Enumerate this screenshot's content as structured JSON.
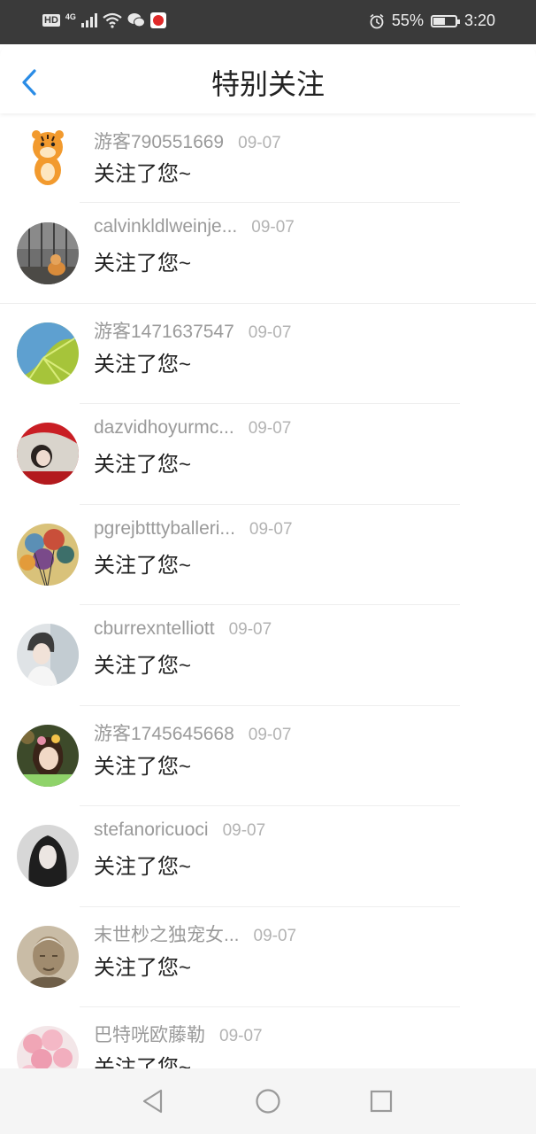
{
  "status_bar": {
    "hd": "HD",
    "network": "4G",
    "battery_percent": "55%",
    "time": "3:20",
    "battery_level": 0.55,
    "icons": [
      "hd-icon",
      "signal-icon",
      "wifi-icon",
      "wechat-icon",
      "app-icon",
      "alarm-icon",
      "battery-icon"
    ]
  },
  "header": {
    "title": "特别关注",
    "back_icon": "chevron-left-icon",
    "accent": "#2a8ce6"
  },
  "items": [
    {
      "username": "游客790551669",
      "date": "09-07",
      "message": "关注了您~",
      "avatar": "tiger-avatar"
    },
    {
      "username": "calvinkldlweinje...",
      "date": "09-07",
      "message": "关注了您~",
      "avatar": "cat-avatar"
    },
    {
      "username": "游客1471637547",
      "date": "09-07",
      "message": "关注了您~",
      "avatar": "leaf-avatar"
    },
    {
      "username": "dazvidhoyurmc...",
      "date": "09-07",
      "message": "关注了您~",
      "avatar": "girl-red-avatar"
    },
    {
      "username": "pgrejbtttyballeri...",
      "date": "09-07",
      "message": "关注了您~",
      "avatar": "balloons-avatar"
    },
    {
      "username": "cburrexntelliott",
      "date": "09-07",
      "message": "关注了您~",
      "avatar": "boy-avatar"
    },
    {
      "username": "游客1745645668",
      "date": "09-07",
      "message": "关注了您~",
      "avatar": "girl-flower-avatar"
    },
    {
      "username": "stefanoricuoci",
      "date": "09-07",
      "message": "关注了您~",
      "avatar": "dark-hair-avatar"
    },
    {
      "username": "末世杪之独宠女...",
      "date": "09-07",
      "message": "关注了您~",
      "avatar": "old-man-avatar"
    },
    {
      "username": "巴特咣欧藤勒",
      "date": "09-07",
      "message": "关注了您~",
      "avatar": "pink-balloons-avatar"
    }
  ],
  "bottom_nav": [
    "back-triangle-icon",
    "home-circle-icon",
    "recents-square-icon"
  ]
}
